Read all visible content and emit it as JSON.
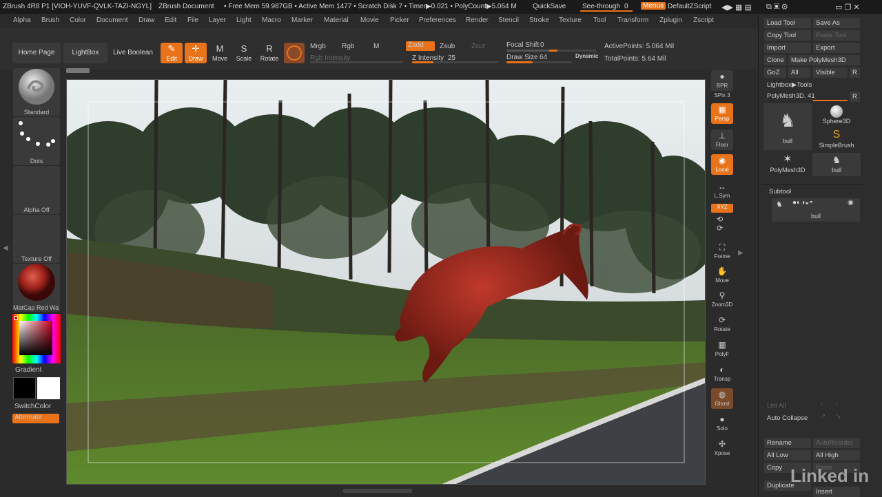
{
  "titlebar": {
    "app": "ZBrush 4R8 P1 [VIOH-YUVF-QVLK-TAZI-NGYL]",
    "doc": "ZBrush Document",
    "mem": "• Free Mem 59.987GB • Active Mem 1477 • Scratch Disk 7 • Timer▶0.021 • PolyCount▶5.064 M",
    "quicksave": "QuickSave",
    "seethrough": "See-through",
    "seethrough_val": "0",
    "menus": "Menus",
    "script": "DefaultZScript"
  },
  "menubar": [
    "Alpha",
    "Brush",
    "Color",
    "Document",
    "Draw",
    "Edit",
    "File",
    "Layer",
    "Light",
    "Macro",
    "Marker",
    "Material",
    "Movie",
    "Picker",
    "Preferences",
    "Render",
    "Stencil",
    "Stroke",
    "Texture",
    "Tool",
    "Transform",
    "Zplugin",
    "Zscript"
  ],
  "shelf": {
    "home": "Home Page",
    "lightbox": "LightBox",
    "liveboolean": "Live Boolean",
    "tools": [
      {
        "label": "Edit",
        "icon": "✎",
        "on": true
      },
      {
        "label": "Draw",
        "icon": "✛",
        "on": true
      },
      {
        "label": "Move",
        "icon": "M",
        "on": false
      },
      {
        "label": "Scale",
        "icon": "S",
        "on": false
      },
      {
        "label": "Rotate",
        "icon": "R",
        "on": false
      }
    ],
    "mrgb": "Mrgb",
    "rgb": "Rgb",
    "m": "M",
    "rgb_intensity": "Rgb Intensity",
    "zadd": "Zadd",
    "zsub": "Zsub",
    "zcut": "Zcut",
    "z_intensity": "Z Intensity",
    "z_intensity_val": "25",
    "focal_shift": "Focal Shift",
    "focal_shift_val": "0",
    "draw_size": "Draw Size",
    "draw_size_val": "64",
    "dynamic": "Dynamic",
    "active_points": "ActivePoints: 5.064 Mil",
    "total_points": "TotalPoints: 5.64 Mil"
  },
  "left": {
    "brush": "Standard",
    "stroke": "Dots",
    "alpha": "Alpha Off",
    "texture": "Texture Off",
    "material": "MatCap Red Wa",
    "gradient": "Gradient",
    "switchcolor": "SwitchColor",
    "alternate": "Alternate"
  },
  "right": [
    {
      "label": "BPR",
      "icon": "●",
      "on": false
    },
    {
      "label": "SPix 3",
      "icon": "",
      "on": false
    },
    {
      "label": "Persp",
      "icon": "▦",
      "on": true
    },
    {
      "label": "Floor",
      "icon": "⊥",
      "on": false
    },
    {
      "label": "Local",
      "icon": "◉",
      "on": true
    },
    {
      "label": "L.Sym",
      "icon": "↔",
      "on": false
    },
    {
      "label": "XYZ",
      "icon": "⟲",
      "on": true
    },
    {
      "label": "Frame",
      "icon": "⛶",
      "on": false
    },
    {
      "label": "Move",
      "icon": "✋",
      "on": false
    },
    {
      "label": "Zoom3D",
      "icon": "⚲",
      "on": false
    },
    {
      "label": "Rotate",
      "icon": "⟳",
      "on": false
    },
    {
      "label": "PolyF",
      "icon": "▦",
      "on": false
    },
    {
      "label": "Transp",
      "icon": "◐",
      "on": false
    },
    {
      "label": "Ghost",
      "icon": "◍",
      "on": true
    },
    {
      "label": "Solo",
      "icon": "●",
      "on": false
    },
    {
      "label": "Xpose",
      "icon": "✣",
      "on": false
    }
  ],
  "toolpanel": {
    "load_tool": "Load Tool",
    "save_as": "Save As",
    "copy_tool": "Copy Tool",
    "paste_tool": "Paste Tool",
    "import": "Import",
    "export": "Export",
    "clone": "Clone",
    "make_polymesh": "Make PolyMesh3D",
    "goz": "GoZ",
    "all": "All",
    "visible": "Visible",
    "r": "R",
    "lightbox_tools": "Lightbox▶Tools",
    "polymesh": "PolyMesh3D. 41",
    "thumbs": [
      "bull",
      "Sphere3D",
      "SimpleBrush",
      "PolyMesh3D",
      "bull"
    ],
    "subtool": "Subtool",
    "subtool_item": "bull",
    "list_all": "List All",
    "auto_collapse": "Auto Collapse",
    "rename": "Rename",
    "auto_reorder": "AutoReorder",
    "all_low": "All Low",
    "all_high": "All High",
    "copy": "Copy",
    "paste": "Paste",
    "duplicate": "Duplicate",
    "insert": "Insert"
  },
  "watermark": "Linked in"
}
